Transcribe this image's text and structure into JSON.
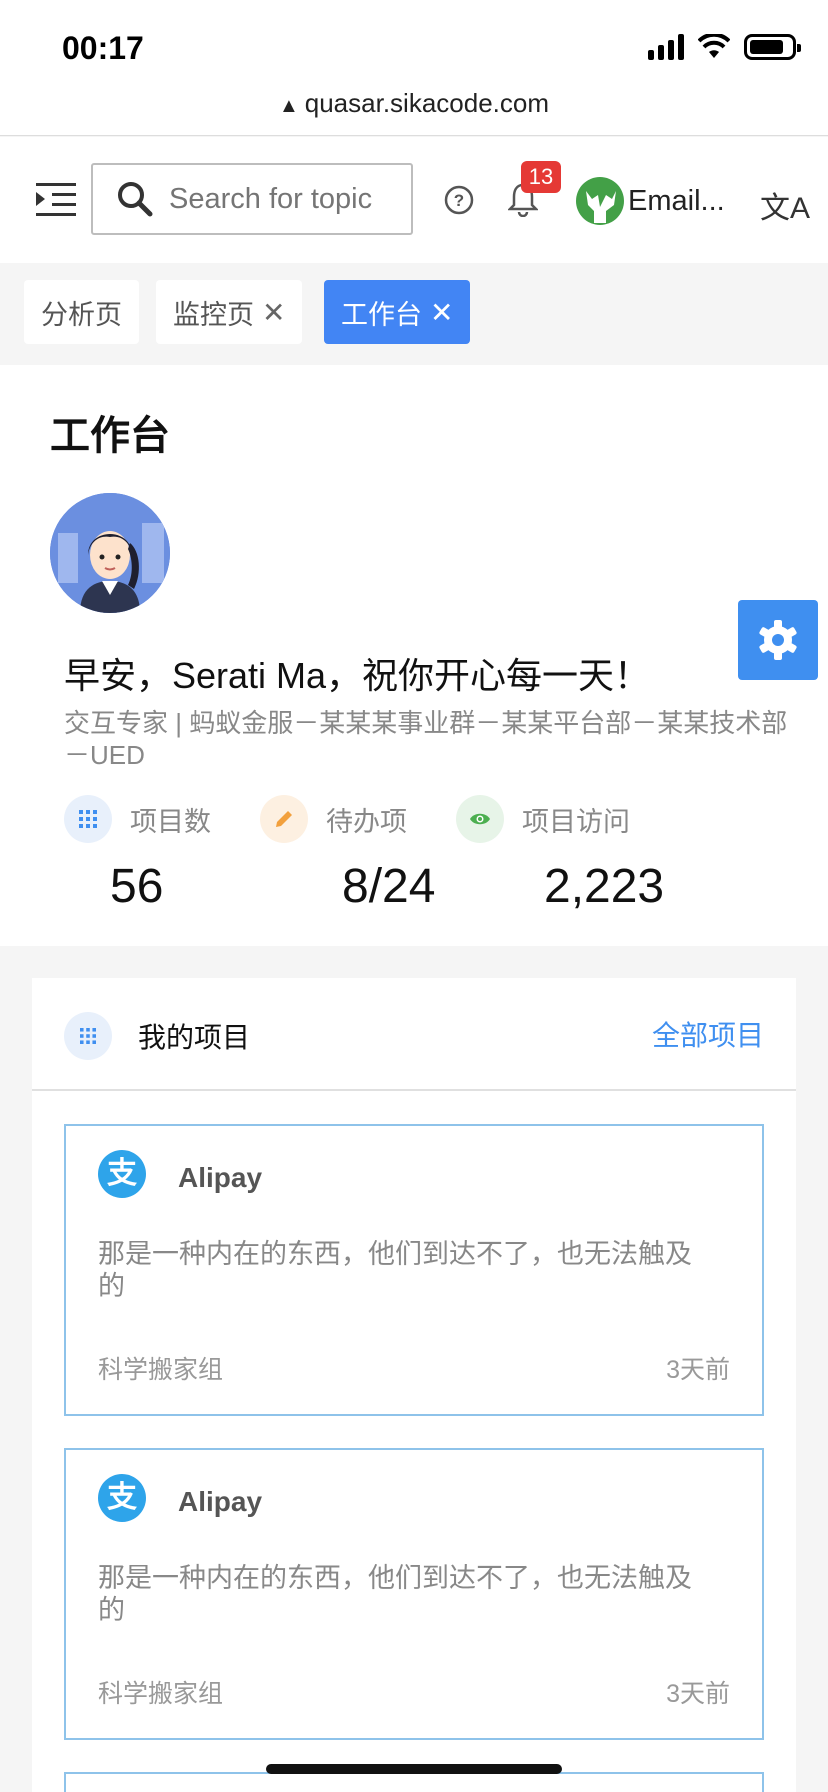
{
  "status_bar": {
    "time": "00:17"
  },
  "browser": {
    "url": "quasar.sikacode.com"
  },
  "header": {
    "search_placeholder": "Search for topic",
    "notification_count": "13",
    "user_name": "Email..."
  },
  "tabs": [
    {
      "label": "分析页",
      "closable": false,
      "active": false
    },
    {
      "label": "监控页",
      "closable": true,
      "active": false
    },
    {
      "label": "工作台",
      "closable": true,
      "active": true
    }
  ],
  "workbench": {
    "title": "工作台",
    "greeting": "早安，Serati Ma，祝你开心每一天！",
    "description": "交互专家 | 蚂蚁金服－某某某事业群－某某平台部－某某技术部－UED",
    "stats": [
      {
        "label": "项目数",
        "value": "56",
        "icon": "grid-icon",
        "color": "#3f8ff0"
      },
      {
        "label": "待办项",
        "value": "8/24",
        "icon": "pencil-icon",
        "color": "#f2a03d"
      },
      {
        "label": "项目访问",
        "value": "2,223",
        "icon": "eye-icon",
        "color": "#4caf50"
      }
    ]
  },
  "projects": {
    "title": "我的项目",
    "all_link": "全部项目",
    "items": [
      {
        "name": "Alipay",
        "logo": "支",
        "description": "那是一种内在的东西，他们到达不了，也无法触及的",
        "group": "科学搬家组",
        "time": "3天前"
      },
      {
        "name": "Alipay",
        "logo": "支",
        "description": "那是一种内在的东西，他们到达不了，也无法触及的",
        "group": "科学搬家组",
        "time": "3天前"
      }
    ]
  },
  "colors": {
    "accent": "#3f8ff0",
    "tab_active": "#4285f4",
    "badge": "#e53935",
    "card_border": "#8ec3ea"
  }
}
